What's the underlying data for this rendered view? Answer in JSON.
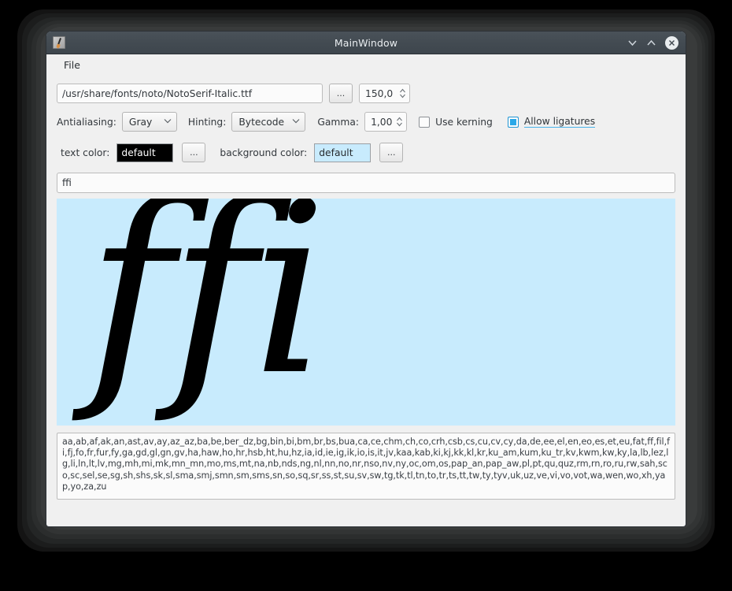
{
  "window": {
    "title": "MainWindow",
    "icon": "qt-designer-icon",
    "controls": {
      "minimize": "minimize-chevron-down",
      "maximize": "maximize-chevron-up",
      "close": "close-x"
    }
  },
  "menubar": {
    "items": [
      {
        "label": "File"
      }
    ]
  },
  "font_row": {
    "path_value": "/usr/share/fonts/noto/NotoSerif-Italic.ttf",
    "browse_label": "...",
    "size_value": "150,0"
  },
  "options_row": {
    "antialiasing_label": "Antialiasing:",
    "antialiasing_value": "Gray",
    "hinting_label": "Hinting:",
    "hinting_value": "Bytecode",
    "gamma_label": "Gamma:",
    "gamma_value": "1,00",
    "use_kerning_label": "Use kerning",
    "use_kerning_checked": false,
    "allow_ligatures_label": "Allow ligatures",
    "allow_ligatures_checked": true
  },
  "colors_row": {
    "text_color_label": "text color:",
    "text_color_value": "default",
    "text_color_swatch": "#000000",
    "text_color_browse": "...",
    "background_color_label": "background color:",
    "background_color_value": "default",
    "background_color_swatch": "#c8ebfd",
    "background_color_browse": "..."
  },
  "sample": {
    "input_value": "ffi",
    "preview_glyph": "ffi",
    "preview_background": "#c8ebfd",
    "preview_foreground": "#000000"
  },
  "languages": {
    "text": "aa,ab,af,ak,an,ast,av,ay,az_az,ba,be,ber_dz,bg,bin,bi,bm,br,bs,bua,ca,ce,chm,ch,co,crh,csb,cs,cu,cv,cy,da,de,ee,el,en,eo,es,et,eu,fat,ff,fil,fi,fj,fo,fr,fur,fy,ga,gd,gl,gn,gv,ha,haw,ho,hr,hsb,ht,hu,hz,ia,id,ie,ig,ik,io,is,it,jv,kaa,kab,ki,kj,kk,kl,kr,ku_am,kum,ku_tr,kv,kwm,kw,ky,la,lb,lez,lg,li,ln,lt,lv,mg,mh,mi,mk,mn_mn,mo,ms,mt,na,nb,nds,ng,nl,nn,no,nr,nso,nv,ny,oc,om,os,pap_an,pap_aw,pl,pt,qu,quz,rm,rn,ro,ru,rw,sah,sco,sc,sel,se,sg,sh,shs,sk,sl,sma,smj,smn,sm,sms,sn,so,sq,sr,ss,st,su,sv,sw,tg,tk,tl,tn,to,tr,ts,tt,tw,ty,tyv,uk,uz,ve,vi,vo,vot,wa,wen,wo,xh,yap,yo,za,zu"
  }
}
